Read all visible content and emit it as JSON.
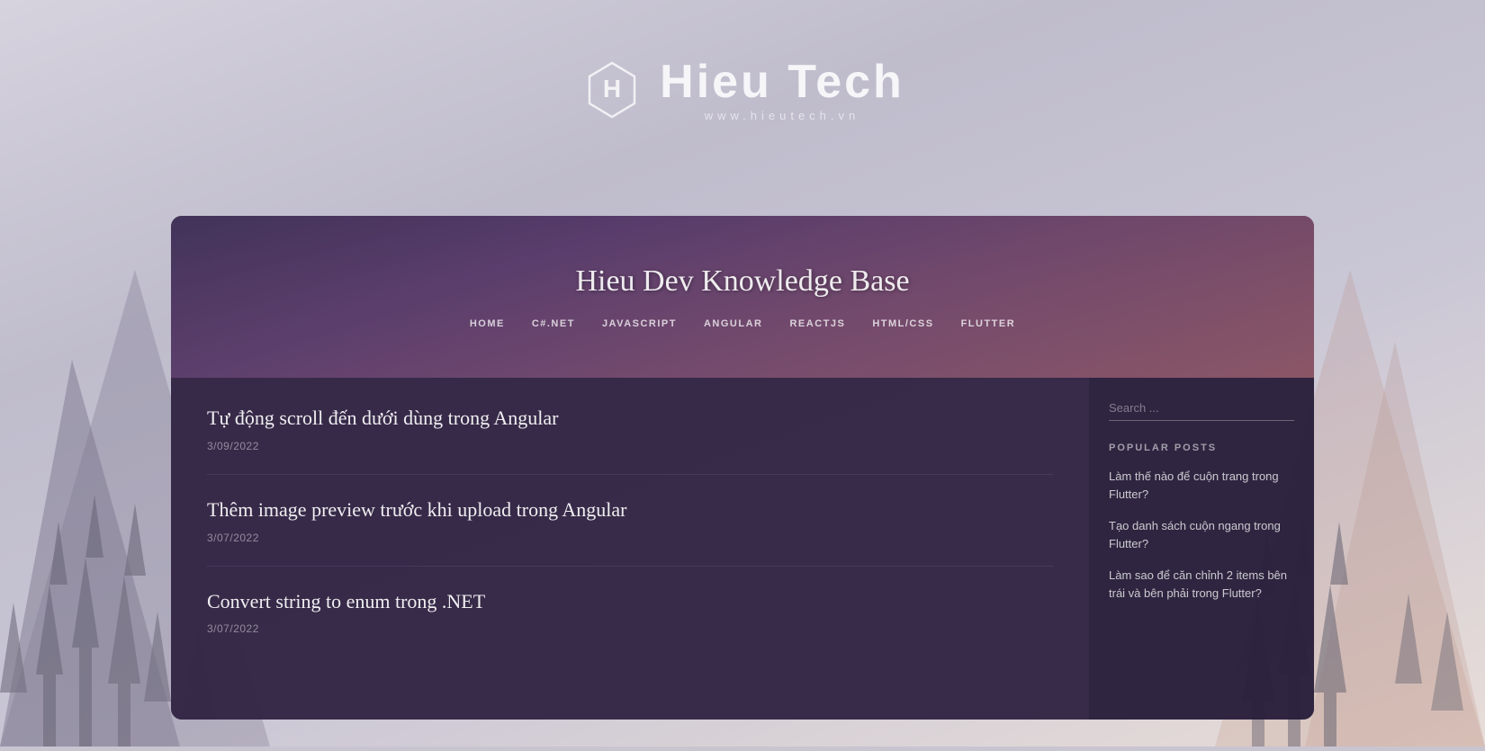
{
  "background": {
    "color": "#c8c5d0"
  },
  "header": {
    "logo_alt": "Hieu Tech Logo",
    "site_name": "Hieu Tech",
    "site_url": "www.hieutech.vn"
  },
  "card": {
    "site_title": "Hieu Dev Knowledge Base",
    "nav": [
      {
        "label": "HOME"
      },
      {
        "label": "C#.NET"
      },
      {
        "label": "JAVASCRIPT"
      },
      {
        "label": "ANGULAR"
      },
      {
        "label": "REACTJS"
      },
      {
        "label": "HTML/CSS"
      },
      {
        "label": "FLUTTER"
      }
    ],
    "posts": [
      {
        "title": "Tự động scroll đến dưới dùng trong Angular",
        "date": "3/09/2022"
      },
      {
        "title": "Thêm image preview trước khi upload trong Angular",
        "date": "3/07/2022"
      },
      {
        "title": "Convert string to enum trong .NET",
        "date": "3/07/2022"
      }
    ],
    "sidebar": {
      "search_placeholder": "Search ...",
      "popular_posts_label": "POPULAR POSTS",
      "popular_posts": [
        {
          "title": "Làm thế nào để cuộn trang trong Flutter?"
        },
        {
          "title": "Tạo danh sách cuộn ngang trong Flutter?"
        },
        {
          "title": "Làm sao để căn chỉnh 2 items bên trái và bên phải trong Flutter?"
        }
      ]
    }
  }
}
